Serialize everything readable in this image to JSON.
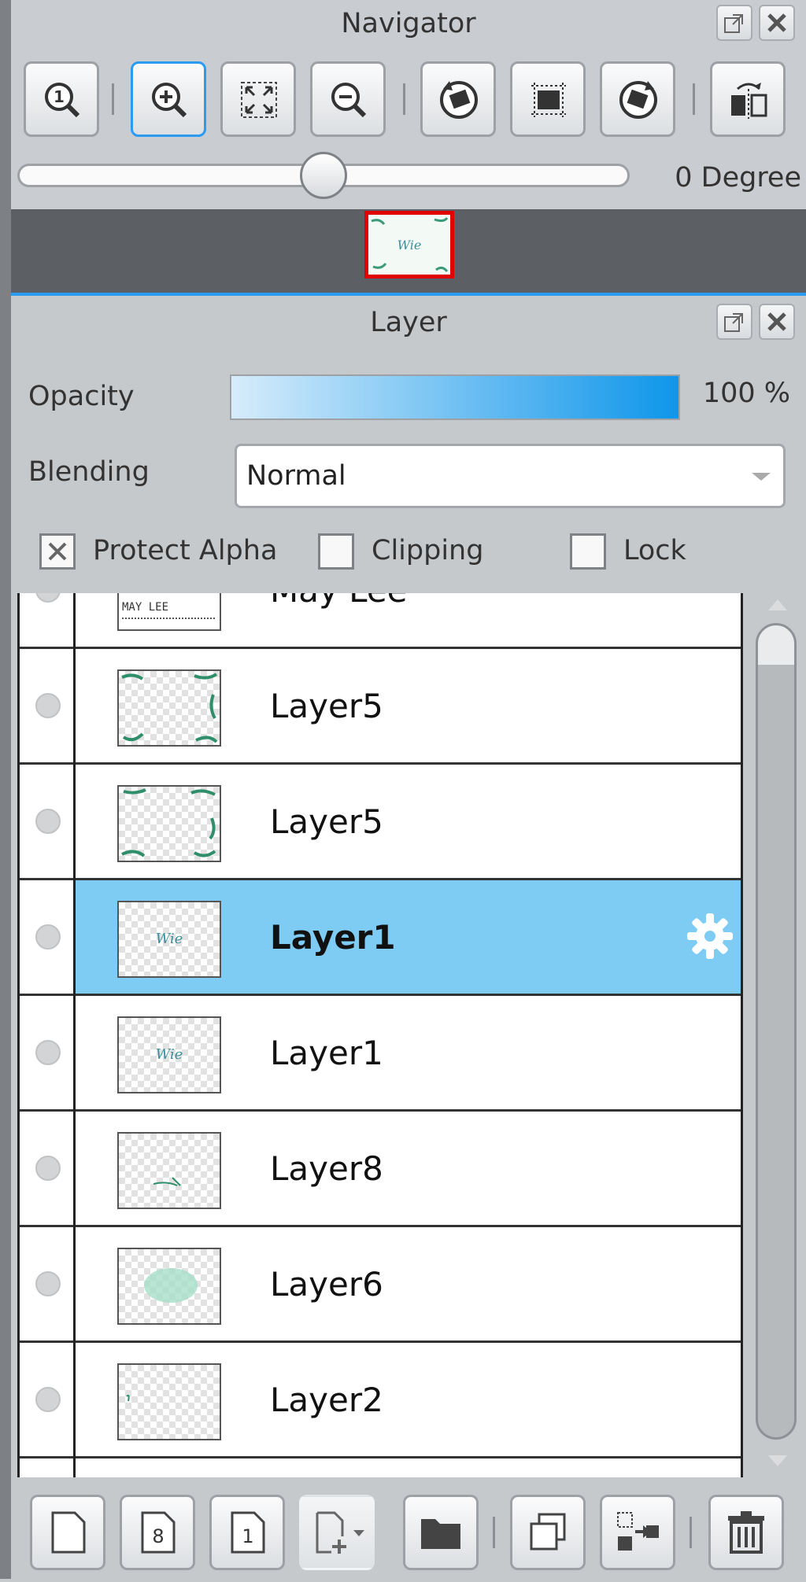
{
  "navigator": {
    "title": "Navigator",
    "rotation_label": "0 Degree",
    "rotation_value": 0,
    "toolbar": [
      {
        "name": "actual-size",
        "icon": "zoom-actual-size-icon"
      },
      {
        "name": "zoom-in",
        "icon": "zoom-in-icon",
        "active": true
      },
      {
        "name": "fit-to-window",
        "icon": "fit-window-icon"
      },
      {
        "name": "zoom-out",
        "icon": "zoom-out-icon"
      },
      {
        "name": "rotate-left",
        "icon": "rotate-left-icon"
      },
      {
        "name": "reset-rotation",
        "icon": "reset-rotation-icon"
      },
      {
        "name": "rotate-right",
        "icon": "rotate-right-icon"
      },
      {
        "name": "flip-horizontal",
        "icon": "flip-horizontal-icon"
      }
    ]
  },
  "layer_panel": {
    "title": "Layer",
    "opacity_label": "Opacity",
    "opacity_value": "100 %",
    "opacity_percent": 100,
    "blending_label": "Blending",
    "blending_value": "Normal",
    "protect_alpha_label": "Protect Alpha",
    "protect_alpha_checked": true,
    "clipping_label": "Clipping",
    "clipping_checked": false,
    "lock_label": "Lock",
    "lock_checked": false,
    "layers": [
      {
        "name": "May Lee"
      },
      {
        "name": "Layer5"
      },
      {
        "name": "Layer5"
      },
      {
        "name": "Layer1",
        "selected": true
      },
      {
        "name": "Layer1"
      },
      {
        "name": "Layer8"
      },
      {
        "name": "Layer6"
      },
      {
        "name": "Layer2"
      }
    ],
    "thumb_text": "MAY LEE",
    "bottom_toolbar": [
      {
        "name": "new-layer",
        "icon": "new-layer-icon"
      },
      {
        "name": "new-8bit-layer",
        "icon": "8bit-layer-icon",
        "text": "8"
      },
      {
        "name": "new-1bit-layer",
        "icon": "1bit-layer-icon",
        "text": "1"
      },
      {
        "name": "add-layer-menu",
        "icon": "add-layer-dropdown-icon"
      },
      {
        "name": "new-folder",
        "icon": "folder-icon"
      },
      {
        "name": "duplicate-layer",
        "icon": "duplicate-layer-icon"
      },
      {
        "name": "merge-down",
        "icon": "merge-down-icon"
      },
      {
        "name": "delete-layer",
        "icon": "trash-icon"
      }
    ]
  },
  "colors": {
    "accent": "#2a9bef",
    "selected_row": "#7ecbf3",
    "preview_border": "#e00000",
    "panel_bg": "#c9ccd0"
  }
}
